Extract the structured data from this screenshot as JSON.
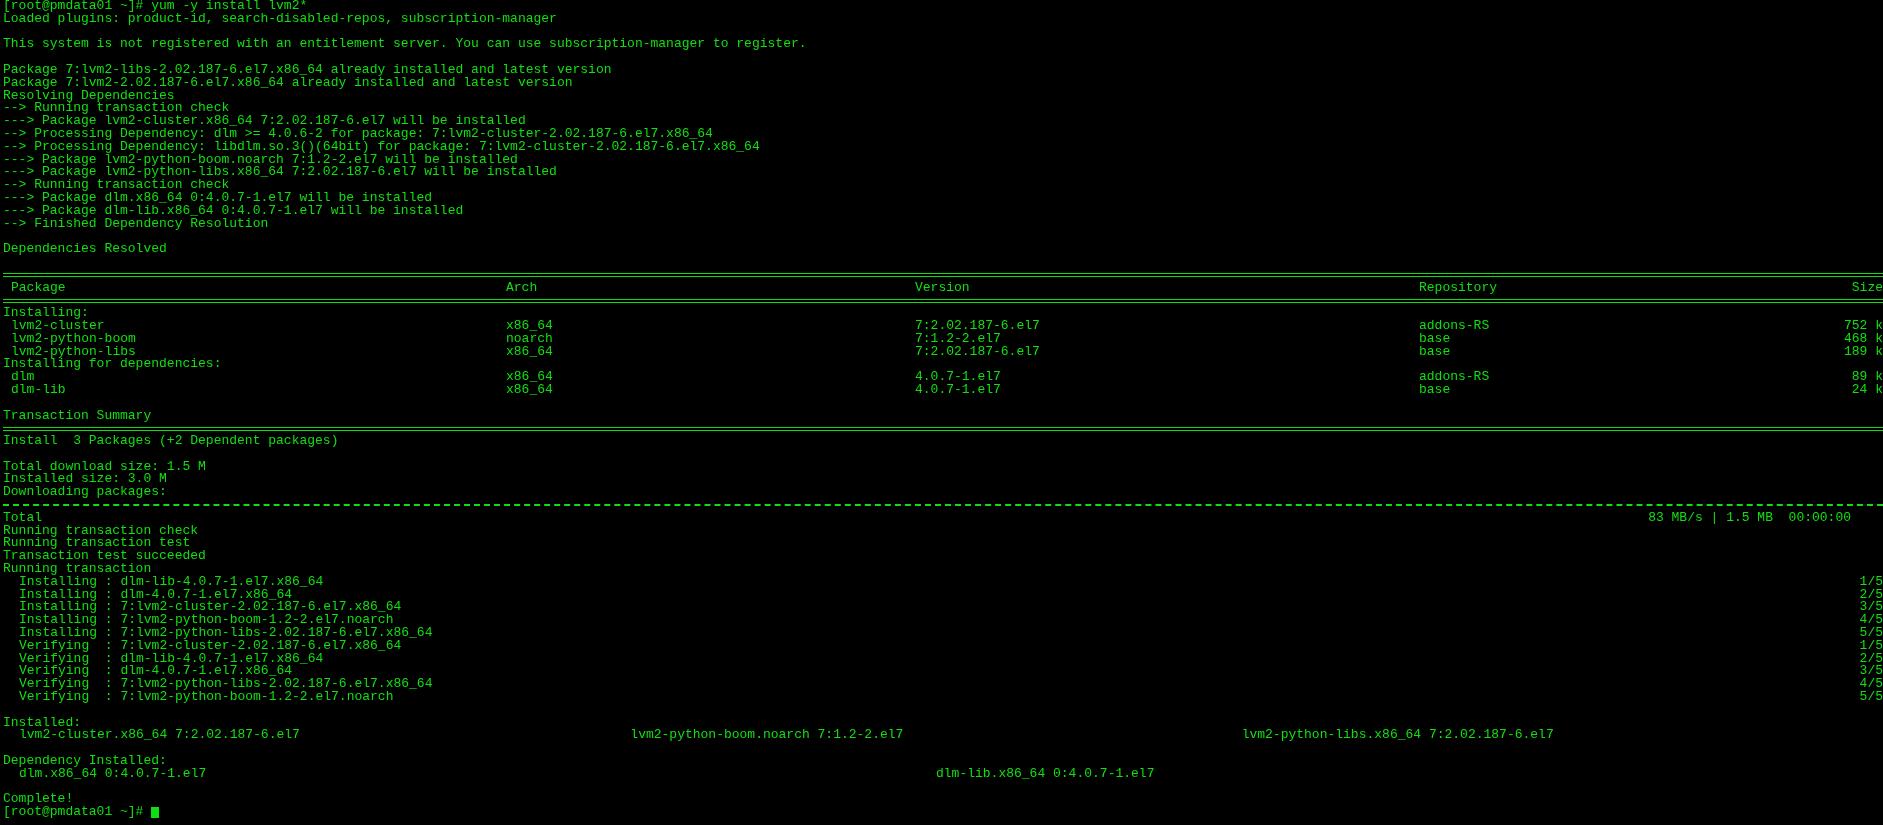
{
  "terminal": {
    "lines": [
      {
        "kind": "text",
        "text": "[root@pmdata01 ~]# yum -y install lvm2*"
      },
      {
        "kind": "text",
        "text": "Loaded plugins: product-id, search-disabled-repos, subscription-manager"
      },
      {
        "kind": "blank"
      },
      {
        "kind": "text",
        "text": "This system is not registered with an entitlement server. You can use subscription-manager to register."
      },
      {
        "kind": "blank"
      },
      {
        "kind": "text",
        "text": "Package 7:lvm2-libs-2.02.187-6.el7.x86_64 already installed and latest version"
      },
      {
        "kind": "text",
        "text": "Package 7:lvm2-2.02.187-6.el7.x86_64 already installed and latest version"
      },
      {
        "kind": "text",
        "text": "Resolving Dependencies"
      },
      {
        "kind": "text",
        "text": "--> Running transaction check"
      },
      {
        "kind": "text",
        "text": "---> Package lvm2-cluster.x86_64 7:2.02.187-6.el7 will be installed"
      },
      {
        "kind": "text",
        "text": "--> Processing Dependency: dlm >= 4.0.6-2 for package: 7:lvm2-cluster-2.02.187-6.el7.x86_64"
      },
      {
        "kind": "text",
        "text": "--> Processing Dependency: libdlm.so.3()(64bit) for package: 7:lvm2-cluster-2.02.187-6.el7.x86_64"
      },
      {
        "kind": "text",
        "text": "---> Package lvm2-python-boom.noarch 7:1.2-2.el7 will be installed"
      },
      {
        "kind": "text",
        "text": "---> Package lvm2-python-libs.x86_64 7:2.02.187-6.el7 will be installed"
      },
      {
        "kind": "text",
        "text": "--> Running transaction check"
      },
      {
        "kind": "text",
        "text": "---> Package dlm.x86_64 0:4.0.7-1.el7 will be installed"
      },
      {
        "kind": "text",
        "text": "---> Package dlm-lib.x86_64 0:4.0.7-1.el7 will be installed"
      },
      {
        "kind": "text",
        "text": "--> Finished Dependency Resolution"
      },
      {
        "kind": "blank"
      },
      {
        "kind": "text",
        "text": "Dependencies Resolved"
      },
      {
        "kind": "blank"
      },
      {
        "kind": "rule_double"
      },
      {
        "kind": "table_row",
        "cells": [
          "Package",
          "Arch",
          "Version",
          "Repository",
          "Size"
        ]
      },
      {
        "kind": "rule_double"
      },
      {
        "kind": "text",
        "text": "Installing:"
      },
      {
        "kind": "table_row",
        "cells": [
          "lvm2-cluster",
          "x86_64",
          "7:2.02.187-6.el7",
          "addons-RS",
          "752 k"
        ]
      },
      {
        "kind": "table_row",
        "cells": [
          "lvm2-python-boom",
          "noarch",
          "7:1.2-2.el7",
          "base",
          "468 k"
        ]
      },
      {
        "kind": "table_row",
        "cells": [
          "lvm2-python-libs",
          "x86_64",
          "7:2.02.187-6.el7",
          "base",
          "189 k"
        ]
      },
      {
        "kind": "text",
        "text": "Installing for dependencies:"
      },
      {
        "kind": "table_row",
        "cells": [
          "dlm",
          "x86_64",
          "4.0.7-1.el7",
          "addons-RS",
          "89 k"
        ]
      },
      {
        "kind": "table_row",
        "cells": [
          "dlm-lib",
          "x86_64",
          "4.0.7-1.el7",
          "base",
          "24 k"
        ]
      },
      {
        "kind": "blank"
      },
      {
        "kind": "text",
        "text": "Transaction Summary"
      },
      {
        "kind": "rule_double"
      },
      {
        "kind": "text",
        "text": "Install  3 Packages (+2 Dependent packages)"
      },
      {
        "kind": "blank"
      },
      {
        "kind": "text",
        "text": "Total download size: 1.5 M"
      },
      {
        "kind": "text",
        "text": "Installed size: 3.0 M"
      },
      {
        "kind": "text",
        "text": "Downloading packages:"
      },
      {
        "kind": "rule_single"
      },
      {
        "kind": "total",
        "text": "Total",
        "stats": "83 MB/s | 1.5 MB  00:00:00"
      },
      {
        "kind": "text",
        "text": "Running transaction check"
      },
      {
        "kind": "text",
        "text": "Running transaction test"
      },
      {
        "kind": "text",
        "text": "Transaction test succeeded"
      },
      {
        "kind": "text",
        "text": "Running transaction"
      },
      {
        "kind": "step",
        "text": "Installing : dlm-lib-4.0.7-1.el7.x86_64",
        "count": "1/5"
      },
      {
        "kind": "step",
        "text": "Installing : dlm-4.0.7-1.el7.x86_64",
        "count": "2/5"
      },
      {
        "kind": "step",
        "text": "Installing : 7:lvm2-cluster-2.02.187-6.el7.x86_64",
        "count": "3/5"
      },
      {
        "kind": "step",
        "text": "Installing : 7:lvm2-python-boom-1.2-2.el7.noarch",
        "count": "4/5"
      },
      {
        "kind": "step",
        "text": "Installing : 7:lvm2-python-libs-2.02.187-6.el7.x86_64",
        "count": "5/5"
      },
      {
        "kind": "step",
        "text": "Verifying  : 7:lvm2-cluster-2.02.187-6.el7.x86_64",
        "count": "1/5"
      },
      {
        "kind": "step",
        "text": "Verifying  : dlm-lib-4.0.7-1.el7.x86_64",
        "count": "2/5"
      },
      {
        "kind": "step",
        "text": "Verifying  : dlm-4.0.7-1.el7.x86_64",
        "count": "3/5"
      },
      {
        "kind": "step",
        "text": "Verifying  : 7:lvm2-python-libs-2.02.187-6.el7.x86_64",
        "count": "4/5"
      },
      {
        "kind": "step",
        "text": "Verifying  : 7:lvm2-python-boom-1.2-2.el7.noarch",
        "count": "5/5"
      },
      {
        "kind": "blank"
      },
      {
        "kind": "text",
        "text": "Installed:"
      },
      {
        "kind": "columns",
        "items": [
          "lvm2-cluster.x86_64 7:2.02.187-6.el7",
          "lvm2-python-boom.noarch 7:1.2-2.el7",
          "lvm2-python-libs.x86_64 7:2.02.187-6.el7"
        ]
      },
      {
        "kind": "blank"
      },
      {
        "kind": "text",
        "text": "Dependency Installed:"
      },
      {
        "kind": "columns",
        "items": [
          "dlm.x86_64 0:4.0.7-1.el7",
          "dlm-lib.x86_64 0:4.0.7-1.el7"
        ]
      },
      {
        "kind": "blank"
      },
      {
        "kind": "text",
        "text": "Complete!"
      },
      {
        "kind": "prompt",
        "text": "[root@pmdata01 ~]#",
        "cursor": true
      }
    ]
  }
}
